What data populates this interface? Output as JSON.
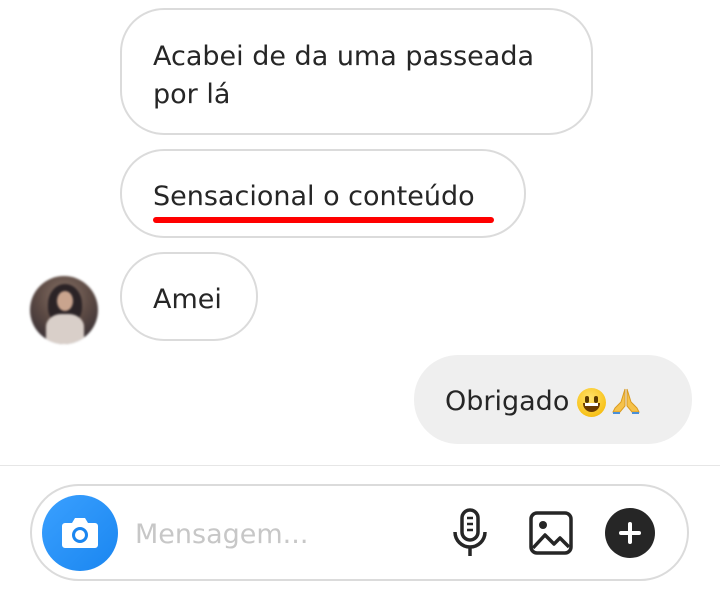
{
  "messages": [
    {
      "direction": "received",
      "text": "Acabei de da uma passeada por lá"
    },
    {
      "direction": "received",
      "text": "Sensacional o conteúdo",
      "underline_color": "#ff0000"
    },
    {
      "direction": "received",
      "text": "Amei"
    },
    {
      "direction": "sent",
      "text": "Obrigado",
      "emojis": [
        "grinning-face",
        "folded-hands"
      ]
    }
  ],
  "composer": {
    "placeholder": "Mensagem...",
    "value": "",
    "icons": [
      "camera-icon",
      "microphone-icon",
      "gallery-icon",
      "plus-icon"
    ]
  },
  "colors": {
    "camera_button": "#1a86f0",
    "received_border": "#dbdbdb",
    "sent_background": "#efefef",
    "text": "#262626",
    "placeholder": "#c7c7c7"
  }
}
